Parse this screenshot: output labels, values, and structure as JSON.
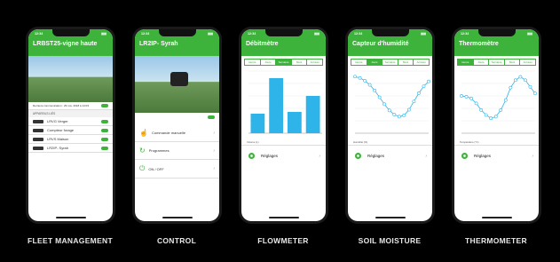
{
  "brand_color": "#3db33b",
  "status_time": "12:34",
  "phones": {
    "fleet": {
      "title": "LRBST25-vigne haute",
      "caption": "FLEET MANAGEMENT",
      "last_comm": "Derniere communication : 29 nov. 2018 à 14:03",
      "section": "APPAREILS LIÉS",
      "devices": [
        "LRVG Verger",
        "Compteur forage",
        "LRVS Maison",
        "LR2IP- Syrah"
      ]
    },
    "control": {
      "title": "LR2IP- Syrah",
      "caption": "CONTROL",
      "items": [
        "Commande manuelle",
        "Programmes",
        "ON / OFF"
      ]
    },
    "flow": {
      "title": "Débitmètre",
      "caption": "FLOWMETER",
      "tabs": [
        "Heure",
        "Jours",
        "Semaine",
        "Mois",
        "Années"
      ],
      "active_tab": 2,
      "legend": "Volume (L)",
      "settings": "Réglages"
    },
    "soil": {
      "title": "Capteur d'humidité",
      "caption": "SOIL MOISTURE",
      "tabs": [
        "Heure",
        "Jours",
        "Semaine",
        "Mois",
        "Années"
      ],
      "active_tab": 1,
      "legend": "Humidité (%)",
      "settings": "Réglages"
    },
    "thermo": {
      "title": "Thermomètre",
      "caption": "THERMOMETER",
      "tabs": [
        "Heure",
        "Jours",
        "Semaine",
        "Mois",
        "Années"
      ],
      "active_tab": 0,
      "legend": "Température (°C)",
      "settings": "Réglages"
    }
  },
  "chart_data": [
    {
      "type": "bar",
      "series": [
        {
          "name": "Volume (L)",
          "values": [
            22,
            62,
            24,
            42
          ]
        }
      ],
      "categories": [
        "",
        "",
        "",
        ""
      ]
    },
    {
      "type": "line",
      "series": [
        {
          "name": "Humidité (%)",
          "values": [
            82,
            80,
            76,
            70,
            62,
            52,
            42,
            33,
            27,
            24,
            26,
            34,
            46,
            58,
            68,
            75
          ]
        }
      ]
    },
    {
      "type": "line",
      "series": [
        {
          "name": "Température (°C)",
          "values": [
            45,
            44,
            42,
            36,
            28,
            22,
            18,
            20,
            28,
            40,
            55,
            64,
            68,
            64,
            56,
            48
          ]
        }
      ]
    }
  ]
}
